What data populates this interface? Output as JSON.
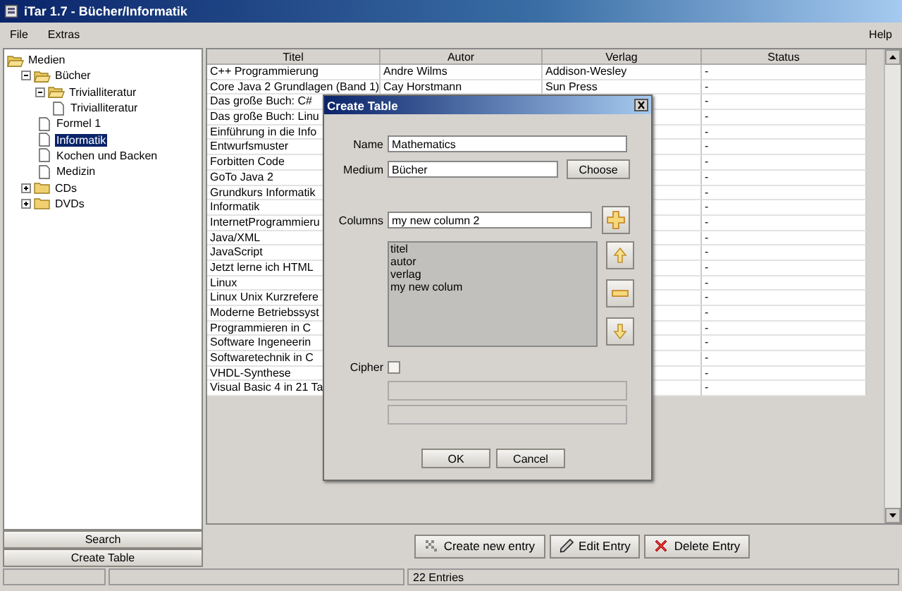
{
  "window": {
    "title": "iTar 1.7 - Bücher/Informatik"
  },
  "menu": {
    "left": [
      "File",
      "Extras"
    ],
    "right": [
      "Help"
    ]
  },
  "tree": [
    {
      "label": "Medien",
      "kind": "folder",
      "expanded": true,
      "selected": false,
      "children": [
        {
          "label": "Bücher",
          "kind": "folder",
          "expanded": true,
          "selected": false,
          "children": [
            {
              "label": "Trivialliteratur",
              "kind": "folder",
              "expanded": true,
              "selected": false,
              "children": [
                {
                  "label": "Trivialliteratur",
                  "kind": "leaf",
                  "selected": false
                }
              ]
            },
            {
              "label": "Formel 1",
              "kind": "leaf",
              "selected": false
            },
            {
              "label": "Informatik",
              "kind": "leaf",
              "selected": true
            },
            {
              "label": "Kochen und Backen",
              "kind": "leaf",
              "selected": false
            },
            {
              "label": "Medizin",
              "kind": "leaf",
              "selected": false
            }
          ]
        },
        {
          "label": "CDs",
          "kind": "folder",
          "expanded": false,
          "selected": false
        },
        {
          "label": "DVDs",
          "kind": "folder",
          "expanded": false,
          "selected": false
        }
      ]
    }
  ],
  "side_buttons": [
    "Search",
    "Create Table"
  ],
  "table": {
    "columns": [
      "Titel",
      "Autor",
      "Verlag",
      "Status"
    ],
    "rows": [
      {
        "titel": "C++ Programmierung",
        "autor": "Andre Wilms",
        "verlag": "Addison-Wesley",
        "status": "-"
      },
      {
        "titel": "Core Java 2 Grundlagen (Band 1)",
        "autor": "Cay Horstmann",
        "verlag": "Sun Press",
        "status": "-"
      },
      {
        "titel": "Das große Buch: C#",
        "status": "-"
      },
      {
        "titel": "Das große Buch: Linu",
        "status": "-"
      },
      {
        "titel": "Einführung in die Info",
        "status": "-"
      },
      {
        "titel": "Entwurfsmuster",
        "status": "-"
      },
      {
        "titel": "Forbitten Code",
        "status": "-"
      },
      {
        "titel": "GoTo Java 2",
        "status": "-"
      },
      {
        "titel": "Grundkurs Informatik",
        "status": "-"
      },
      {
        "titel": "Informatik",
        "status": "-"
      },
      {
        "titel": "InternetProgrammieru",
        "status": "-"
      },
      {
        "titel": "Java/XML",
        "status": "-"
      },
      {
        "titel": "JavaScript",
        "status": "-"
      },
      {
        "titel": "Jetzt lerne ich HTML",
        "status": "-"
      },
      {
        "titel": "Linux",
        "status": "-"
      },
      {
        "titel": "Linux Unix Kurzrefere",
        "status": "-"
      },
      {
        "titel": "Moderne Betriebssyst",
        "status": "-"
      },
      {
        "titel": "Programmieren in C",
        "status": "-"
      },
      {
        "titel": "Software Ingeneerin",
        "status": "-"
      },
      {
        "titel": "Softwaretechnik in C",
        "status": "-"
      },
      {
        "titel": "VHDL-Synthese",
        "status": "-"
      },
      {
        "titel": "Visual Basic 4 in 21 Ta",
        "status": "-"
      }
    ]
  },
  "actions": [
    {
      "label": "Create new entry",
      "kind": "create"
    },
    {
      "label": "Edit Entry",
      "kind": "edit"
    },
    {
      "label": "Delete Entry",
      "kind": "delete"
    }
  ],
  "status_bar": {
    "entries": "22 Entries"
  },
  "dialog": {
    "title": "Create Table",
    "name": {
      "label": "Name",
      "value": "Mathematics"
    },
    "medium": {
      "label": "Medium",
      "value": "Bücher",
      "button": "Choose"
    },
    "columns": {
      "label": "Columns",
      "value": "my new column 2",
      "items": [
        "titel",
        "autor",
        "verlag",
        "my new colum"
      ]
    },
    "column_buttons": [
      {
        "kind": "add"
      },
      {
        "kind": "up"
      },
      {
        "kind": "remove"
      },
      {
        "kind": "down"
      }
    ],
    "cipher": {
      "label": "Cipher",
      "checked": false
    },
    "cipher_fields": [
      {
        "disabled": true
      },
      {
        "disabled": true
      }
    ],
    "buttons": [
      "OK",
      "Cancel"
    ]
  }
}
